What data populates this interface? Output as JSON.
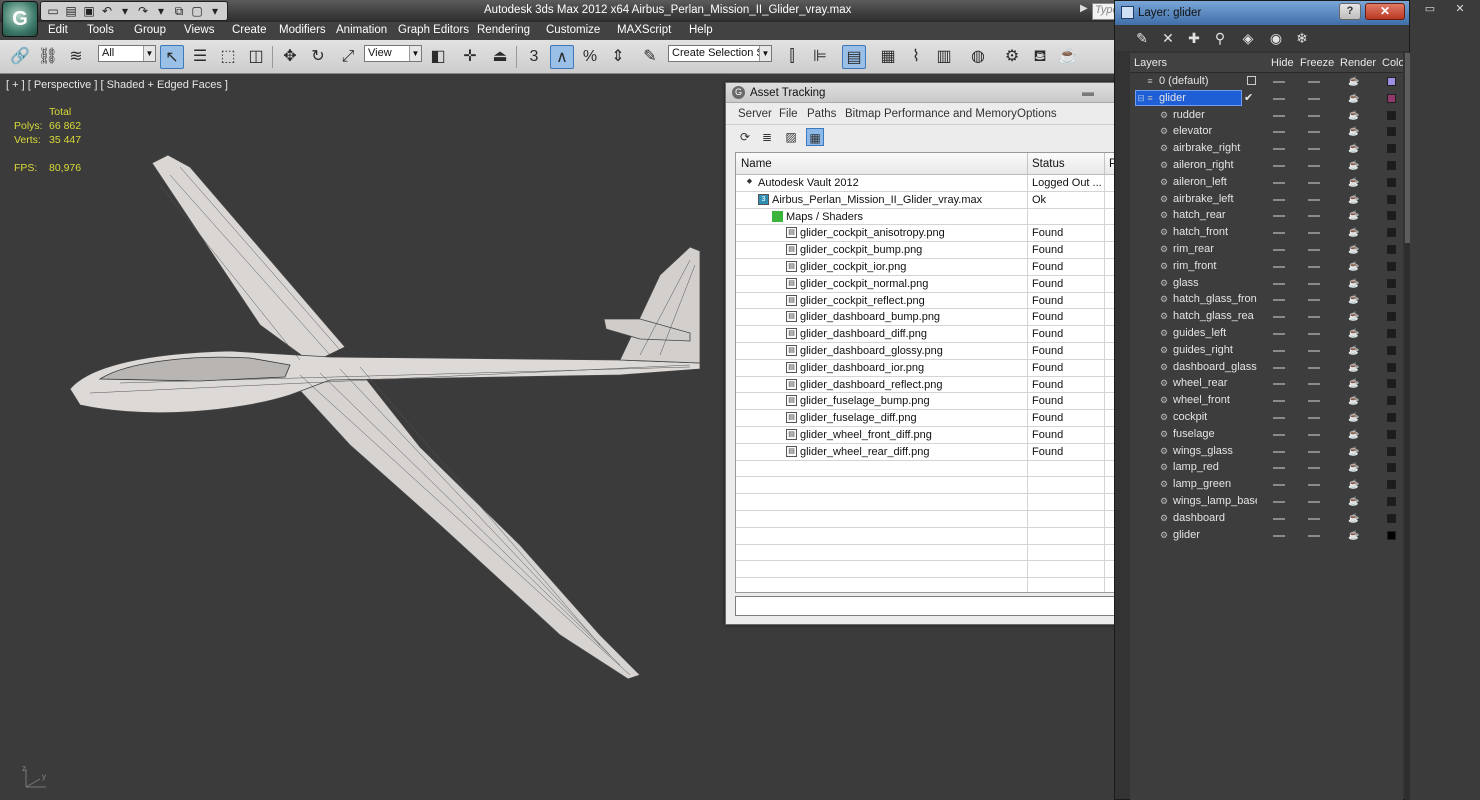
{
  "app": {
    "title": "Autodesk 3ds Max  2012 x64     Airbus_Perlan_Mission_II_Glider_vray.max",
    "logo_text": "G",
    "search_text": "Type"
  },
  "menu": [
    "Edit",
    "Tools",
    "Group",
    "Views",
    "Create",
    "Modifiers",
    "Animation",
    "Graph Editors",
    "Rendering",
    "Customize",
    "MAXScript",
    "Help"
  ],
  "toolbar": {
    "filter_value": "All",
    "refcoord_value": "View",
    "selection_set_placeholder": "Create Selection Se",
    "snap_3_label": "3",
    "percent_label": "%"
  },
  "viewport": {
    "label": "[ + ] [ Perspective ] [ Shaded + Edged Faces ]",
    "stats": {
      "total_label": "Total",
      "polys_label": "Polys:",
      "polys_value": "66 862",
      "verts_label": "Verts:",
      "verts_value": "35 447",
      "fps_label": "FPS:",
      "fps_value": "80,976"
    }
  },
  "asset_tracking": {
    "title": "Asset Tracking",
    "menu": [
      "Server",
      "File",
      "Paths",
      "Bitmap Performance and Memory",
      "Options"
    ],
    "columns": {
      "name": "Name",
      "status": "Status",
      "extra": "P"
    },
    "rows": [
      {
        "name": "Autodesk Vault 2012",
        "status": "Logged Out ...",
        "level": 1
      },
      {
        "name": "Airbus_Perlan_Mission_II_Glider_vray.max",
        "status": "Ok",
        "level": 2
      },
      {
        "name": "Maps / Shaders",
        "status": "",
        "level": 3
      },
      {
        "name": "glider_cockpit_anisotropy.png",
        "status": "Found",
        "level": 4
      },
      {
        "name": "glider_cockpit_bump.png",
        "status": "Found",
        "level": 4
      },
      {
        "name": "glider_cockpit_ior.png",
        "status": "Found",
        "level": 4
      },
      {
        "name": "glider_cockpit_normal.png",
        "status": "Found",
        "level": 4
      },
      {
        "name": "glider_cockpit_reflect.png",
        "status": "Found",
        "level": 4
      },
      {
        "name": "glider_dashboard_bump.png",
        "status": "Found",
        "level": 4
      },
      {
        "name": "glider_dashboard_diff.png",
        "status": "Found",
        "level": 4
      },
      {
        "name": "glider_dashboard_glossy.png",
        "status": "Found",
        "level": 4
      },
      {
        "name": "glider_dashboard_ior.png",
        "status": "Found",
        "level": 4
      },
      {
        "name": "glider_dashboard_reflect.png",
        "status": "Found",
        "level": 4
      },
      {
        "name": "glider_fuselage_bump.png",
        "status": "Found",
        "level": 4
      },
      {
        "name": "glider_fuselage_diff.png",
        "status": "Found",
        "level": 4
      },
      {
        "name": "glider_wheel_front_diff.png",
        "status": "Found",
        "level": 4
      },
      {
        "name": "glider_wheel_rear_diff.png",
        "status": "Found",
        "level": 4
      }
    ]
  },
  "layer_dialog": {
    "title": "Layer: glider",
    "help_label": "?",
    "close_label": "✕",
    "columns": {
      "layers": "Layers",
      "hide": "Hide",
      "freeze": "Freeze",
      "render": "Render",
      "color": "Color"
    },
    "layers": [
      {
        "name": "0 (default)",
        "level": 0,
        "color": "#9a8fe0"
      },
      {
        "name": "glider",
        "level": 0,
        "color": "#8f3a6a",
        "selected": true
      },
      {
        "name": "rudder",
        "level": 1,
        "color": "#1c1c1c"
      },
      {
        "name": "elevator",
        "level": 1,
        "color": "#1c1c1c"
      },
      {
        "name": "airbrake_right",
        "level": 1,
        "color": "#1c1c1c"
      },
      {
        "name": "aileron_right",
        "level": 1,
        "color": "#1c1c1c"
      },
      {
        "name": "aileron_left",
        "level": 1,
        "color": "#1c1c1c"
      },
      {
        "name": "airbrake_left",
        "level": 1,
        "color": "#1c1c1c"
      },
      {
        "name": "hatch_rear",
        "level": 1,
        "color": "#1c1c1c"
      },
      {
        "name": "hatch_front",
        "level": 1,
        "color": "#1c1c1c"
      },
      {
        "name": "rim_rear",
        "level": 1,
        "color": "#1c1c1c"
      },
      {
        "name": "rim_front",
        "level": 1,
        "color": "#1c1c1c"
      },
      {
        "name": "glass",
        "level": 1,
        "color": "#1c1c1c"
      },
      {
        "name": "hatch_glass_fron",
        "level": 1,
        "color": "#1c1c1c"
      },
      {
        "name": "hatch_glass_rea",
        "level": 1,
        "color": "#1c1c1c"
      },
      {
        "name": "guides_left",
        "level": 1,
        "color": "#1c1c1c"
      },
      {
        "name": "guides_right",
        "level": 1,
        "color": "#1c1c1c"
      },
      {
        "name": "dashboard_glass",
        "level": 1,
        "color": "#1c1c1c"
      },
      {
        "name": "wheel_rear",
        "level": 1,
        "color": "#1c1c1c"
      },
      {
        "name": "wheel_front",
        "level": 1,
        "color": "#1c1c1c"
      },
      {
        "name": "cockpit",
        "level": 1,
        "color": "#1c1c1c"
      },
      {
        "name": "fuselage",
        "level": 1,
        "color": "#1c1c1c"
      },
      {
        "name": "wings_glass",
        "level": 1,
        "color": "#1c1c1c"
      },
      {
        "name": "lamp_red",
        "level": 1,
        "color": "#1c1c1c"
      },
      {
        "name": "lamp_green",
        "level": 1,
        "color": "#1c1c1c"
      },
      {
        "name": "wings_lamp_base",
        "level": 1,
        "color": "#1c1c1c"
      },
      {
        "name": "dashboard",
        "level": 1,
        "color": "#1c1c1c"
      },
      {
        "name": "glider",
        "level": 1,
        "color": "#000000"
      }
    ]
  },
  "axis": {
    "x": "x",
    "y": "y",
    "z": "z"
  }
}
